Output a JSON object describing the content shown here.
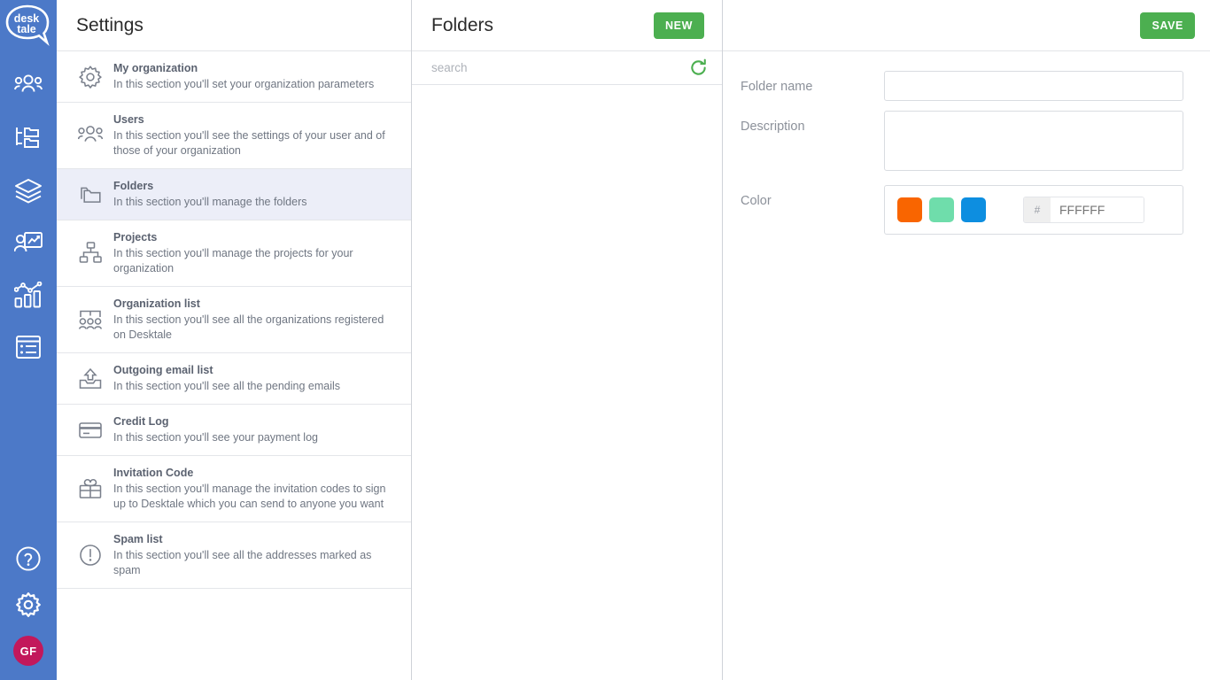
{
  "brand": {
    "logo_line1": "desk",
    "logo_line2": "tale",
    "sidebar_color": "#4C79C8",
    "accent_green": "#4CAF50",
    "avatar_color": "#C2185B",
    "active_row_color": "#ECEEF8"
  },
  "rail": {
    "items": [
      {
        "icon": "contacts-icon",
        "name": "nav-contacts"
      },
      {
        "icon": "folder-tree-icon",
        "name": "nav-folder-tree"
      },
      {
        "icon": "layers-icon",
        "name": "nav-layers"
      },
      {
        "icon": "campaign-icon",
        "name": "nav-campaigns"
      },
      {
        "icon": "analytics-icon",
        "name": "nav-analytics"
      },
      {
        "icon": "list-icon",
        "name": "nav-list"
      }
    ],
    "bottom": [
      {
        "icon": "help-icon",
        "name": "nav-help"
      },
      {
        "icon": "gear-icon",
        "name": "nav-settings"
      }
    ],
    "avatar_initials": "GF"
  },
  "settings": {
    "title": "Settings",
    "items": [
      {
        "icon": "gear-icon",
        "title": "My organization",
        "description": "In this section you'll set your organization parameters",
        "active": false
      },
      {
        "icon": "users-icon",
        "title": "Users",
        "description": "In this section you'll see the settings of your user and of those of your organization",
        "active": false
      },
      {
        "icon": "folders-icon",
        "title": "Folders",
        "description": "In this section you'll manage the folders",
        "active": true
      },
      {
        "icon": "sitemap-icon",
        "title": "Projects",
        "description": "In this section you'll manage the projects for your organization",
        "active": false
      },
      {
        "icon": "organization-group-icon",
        "title": "Organization list",
        "description": "In this section you'll see all the organizations registered on Desktale",
        "active": false
      },
      {
        "icon": "outbox-icon",
        "title": "Outgoing email list",
        "description": "In this section you'll see all the pending emails",
        "active": false
      },
      {
        "icon": "credit-card-icon",
        "title": "Credit Log",
        "description": "In this section you'll see your payment log",
        "active": false
      },
      {
        "icon": "gift-icon",
        "title": "Invitation Code",
        "description": "In this section you'll manage the invitation codes to sign up to Desktale which you can send to anyone you want",
        "active": false
      },
      {
        "icon": "alert-circle-icon",
        "title": "Spam list",
        "description": "In this section you'll see all the addresses marked as spam",
        "active": false
      }
    ]
  },
  "folders_panel": {
    "title": "Folders",
    "new_button": "NEW",
    "search_placeholder": "search",
    "search_value": "",
    "refresh_icon": "refresh-icon",
    "items": []
  },
  "detail": {
    "save_button": "SAVE",
    "fields": {
      "folder_name_label": "Folder name",
      "folder_name_value": "",
      "description_label": "Description",
      "description_value": "",
      "color_label": "Color",
      "hex_prefix": "#",
      "hex_value": "",
      "hex_placeholder": "FFFFFF",
      "swatches": [
        "#F96500",
        "#6FDDAB",
        "#0D8EE0"
      ]
    }
  }
}
